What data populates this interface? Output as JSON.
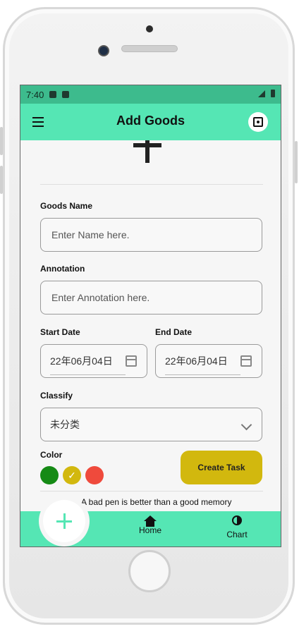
{
  "status_bar": {
    "time": "7:40"
  },
  "app_bar": {
    "title": "Add Goods",
    "menu_icon": "hamburger-menu-icon",
    "scan_icon": "scan-icon"
  },
  "form": {
    "goods_name": {
      "label": "Goods Name",
      "placeholder": "Enter Name here."
    },
    "annotation": {
      "label": "Annotation",
      "placeholder": "Enter Annotation here."
    },
    "start_date": {
      "label": "Start Date",
      "value": "22年06月04日"
    },
    "end_date": {
      "label": "End Date",
      "value": "22年06月04日"
    },
    "classify": {
      "label": "Classify",
      "value": "未分类"
    },
    "color": {
      "label": "Color",
      "options": [
        {
          "name": "green",
          "hex": "#158a15",
          "selected": false
        },
        {
          "name": "yellow",
          "hex": "#d2b80e",
          "selected": true
        },
        {
          "name": "red",
          "hex": "#ef4a3c",
          "selected": false
        }
      ]
    },
    "create_button": "Create Task"
  },
  "motto": "A bad pen is better than a good memory",
  "bottom_nav": {
    "items": [
      {
        "label": "Home",
        "icon": "home-icon"
      },
      {
        "label": "Chart",
        "icon": "chart-icon"
      }
    ],
    "fab_icon": "plus-icon"
  },
  "colors": {
    "accent": "#55e6b4",
    "status": "#3dbb8d",
    "button": "#d2b80e"
  }
}
